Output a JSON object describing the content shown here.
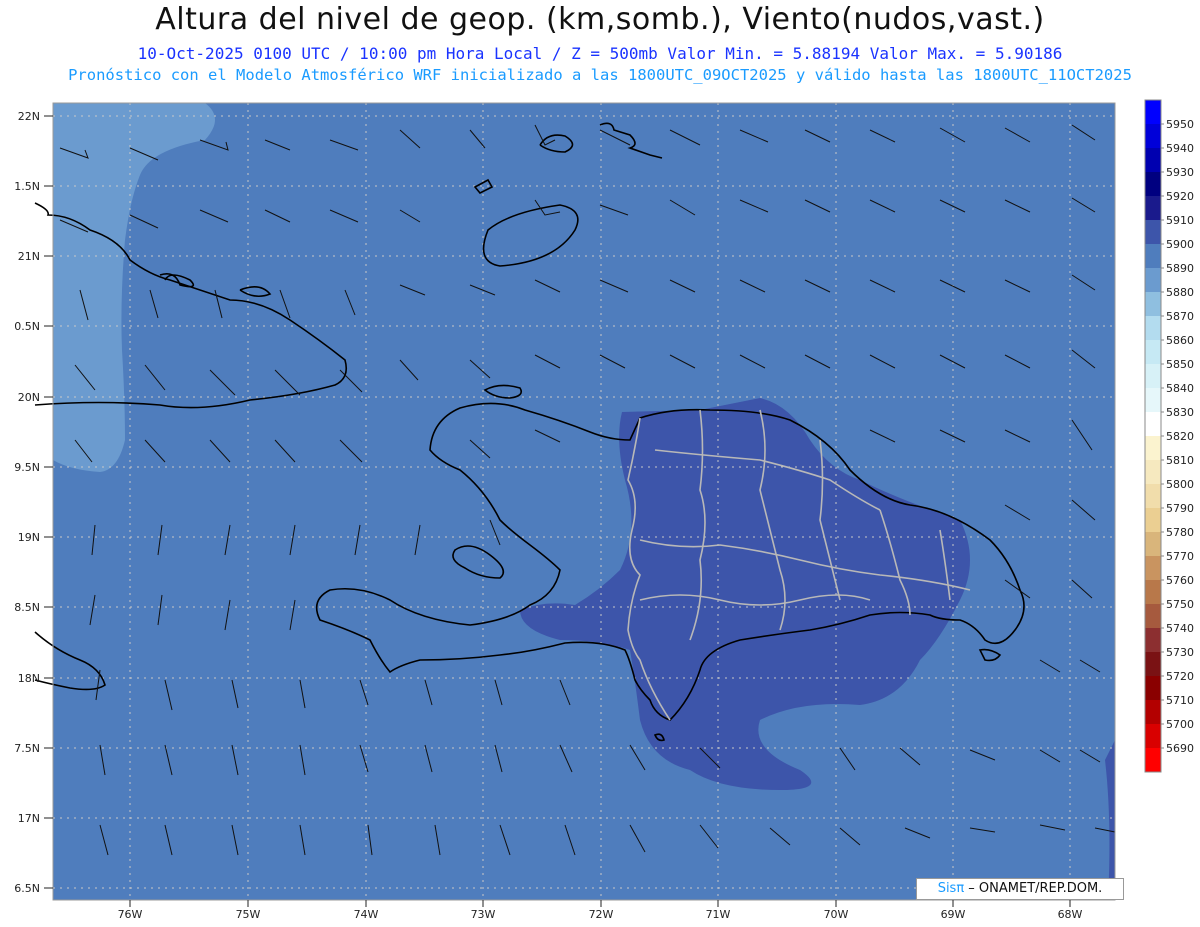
{
  "header": {
    "title": "Altura del nivel de geop. (km,somb.), Viento(nudos,vast.)",
    "subtitle1": "10-Oct-2025  0100 UTC / 10:00 pm Hora Local / Z = 500mb    Valor Min. = 5.88194  Valor Max. = 5.90186",
    "subtitle2": "Pronóstico con el Modelo Atmosférico WRF inicializado a las 1800UTC_09OCT2025 y válido hasta las  1800UTC_11OCT2025"
  },
  "axes": {
    "lat_labels": [
      "22N",
      "1.5N",
      "21N",
      "0.5N",
      "20N",
      "9.5N",
      "19N",
      "8.5N",
      "18N",
      "7.5N",
      "17N",
      "6.5N"
    ],
    "lon_labels": [
      "76W",
      "75W",
      "74W",
      "73W",
      "72W",
      "71W",
      "70W",
      "69W",
      "68W"
    ]
  },
  "colorbar": {
    "levels": [
      "5950",
      "5940",
      "5930",
      "5920",
      "5910",
      "5900",
      "5890",
      "5880",
      "5870",
      "5860",
      "5850",
      "5840",
      "5830",
      "5820",
      "5810",
      "5800",
      "5790",
      "5780",
      "5770",
      "5760",
      "5750",
      "5740",
      "5730",
      "5720",
      "5710",
      "5700",
      "5690"
    ],
    "colors": [
      "#0000ff",
      "#0000d9",
      "#0000b0",
      "#000080",
      "#1a1a8c",
      "#3d55aa",
      "#4f7dbd",
      "#6b9bcf",
      "#8fbfe0",
      "#b3dcef",
      "#c6e9f4",
      "#d7f1f7",
      "#e6f7fa",
      "#ffffff",
      "#fbf3cf",
      "#f6e9bf",
      "#f1ddab",
      "#ebcf92",
      "#d9b57b",
      "#c99460",
      "#b8784a",
      "#a65a3e",
      "#8c2f30",
      "#7a1214",
      "#8a0000",
      "#b30000",
      "#d90000",
      "#ff0000"
    ]
  },
  "credit": {
    "brand": "Sisπ",
    "text": " – ONAMET/REP.DOM."
  },
  "colors": {
    "map_bg": "#4f7dbd",
    "low_region": "#6b9bcf",
    "high_region": "#3d55aa",
    "grid": "#c8c8c8",
    "coast": "#000000",
    "borders": "#b8b8b8"
  }
}
